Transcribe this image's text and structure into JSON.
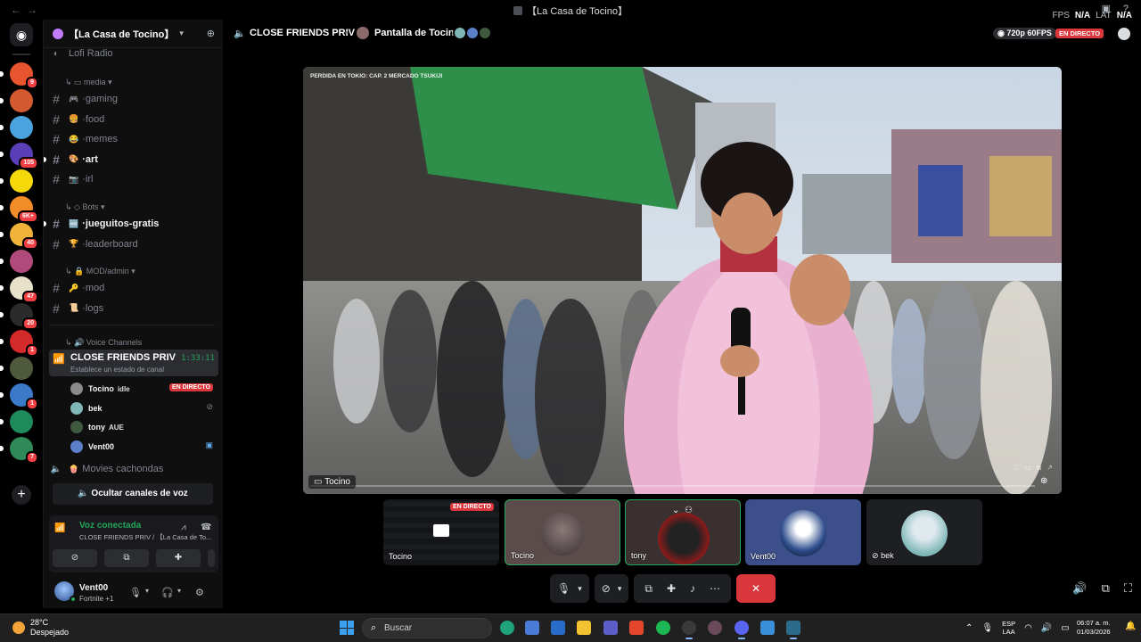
{
  "window": {
    "title": "【La Casa de Tocino】",
    "stats": {
      "fps_label": "FPS",
      "fps_value": "N/A",
      "lat_label": "LAT",
      "lat_value": "N/A"
    }
  },
  "servers": [
    {
      "badge": "9",
      "color": "#e8542e"
    },
    {
      "badge": "",
      "color": "#d35a2f"
    },
    {
      "badge": "",
      "color": "#4aa3df"
    },
    {
      "badge": "105",
      "color": "#5b3fb8"
    },
    {
      "badge": "",
      "color": "#f5d90a"
    },
    {
      "badge": "6K+",
      "color": "#f28c28"
    },
    {
      "badge": "40",
      "color": "#f2b33a"
    },
    {
      "badge": "",
      "color": "#b04a7a"
    },
    {
      "badge": "47",
      "color": "#e6e1c8"
    },
    {
      "badge": "20",
      "color": "#2b2b2b"
    },
    {
      "badge": "1",
      "color": "#d42a2a"
    },
    {
      "badge": "",
      "color": "#4f5a3c"
    },
    {
      "badge": "1",
      "color": "#3b79c9"
    },
    {
      "badge": "",
      "color": "#1f8a5a"
    },
    {
      "badge": "7",
      "color": "#2e8b57"
    }
  ],
  "guild": {
    "name": "【La Casa de Tocino】"
  },
  "channels": {
    "lofi": "Lofi Radio",
    "media_category": "media",
    "media": [
      {
        "emoji": "🎮",
        "name": "gaming",
        "unread": false
      },
      {
        "emoji": "🍔",
        "name": "food",
        "unread": false
      },
      {
        "emoji": "😂",
        "name": "memes",
        "unread": false
      },
      {
        "emoji": "🎨",
        "name": "art",
        "unread": true
      },
      {
        "emoji": "📷",
        "name": "irl",
        "unread": false
      }
    ],
    "bots_category": "Bots",
    "bots": [
      {
        "emoji": "🆓",
        "name": "jueguitos-gratis",
        "unread": true
      },
      {
        "emoji": "🏆",
        "name": "leaderboard",
        "unread": false
      }
    ],
    "mod_category": "MOD/admin",
    "mod": [
      {
        "emoji": "🔑",
        "name": "mod",
        "unread": false
      },
      {
        "emoji": "📜",
        "name": "logs",
        "unread": false
      }
    ],
    "voice_category": "Voice Channels",
    "active_voice": {
      "name": "CLOSE FRIENDS PRIV",
      "time": "1:33:11",
      "status_hint": "Establece un estado de canal"
    },
    "voice_users": [
      {
        "name": "Tocino",
        "activity": "idle",
        "live": "EN DIRECTO",
        "color": "#8a8a8a"
      },
      {
        "name": "bek",
        "activity": "",
        "live": "",
        "color": "#7fb7b7"
      },
      {
        "name": "tony",
        "activity": "AUE",
        "live": "",
        "color": "#3f5a3f"
      },
      {
        "name": "Vent00",
        "activity": "",
        "live": "",
        "color": "#5b7fc9"
      }
    ],
    "other_voice": "Movies cachondas",
    "hide_voice_label": "Ocultar canales de voz"
  },
  "voice_panel": {
    "title": "Voz conectada",
    "subtitle": "CLOSE FRIENDS PRIV / 【La Casa de To..."
  },
  "user": {
    "name": "Vent00",
    "status": "Fortnite +1"
  },
  "main": {
    "channel": "CLOSE FRIENDS PRIV",
    "screen_share": "Pantalla de Tocino",
    "quality": "720p 60FPS",
    "live": "EN DIRECTO",
    "stream_caption": "PERDIDA EN TOKIO: CAP. 2 MERCADO TSUKIJI",
    "stream_owner": "Tocino"
  },
  "tiles": [
    {
      "label": "Tocino",
      "live": "EN DIRECTO"
    },
    {
      "label": "Tocino",
      "live": ""
    },
    {
      "label": "tony",
      "live": ""
    },
    {
      "label": "Vent00",
      "live": ""
    },
    {
      "label": "bek",
      "live": ""
    }
  ],
  "taskbar": {
    "temp": "28°C",
    "weather": "Despejado",
    "search": "Buscar",
    "lang1": "ESP",
    "lang2": "LAA",
    "time": "06:07 a. m.",
    "date": "01/03/2026"
  }
}
